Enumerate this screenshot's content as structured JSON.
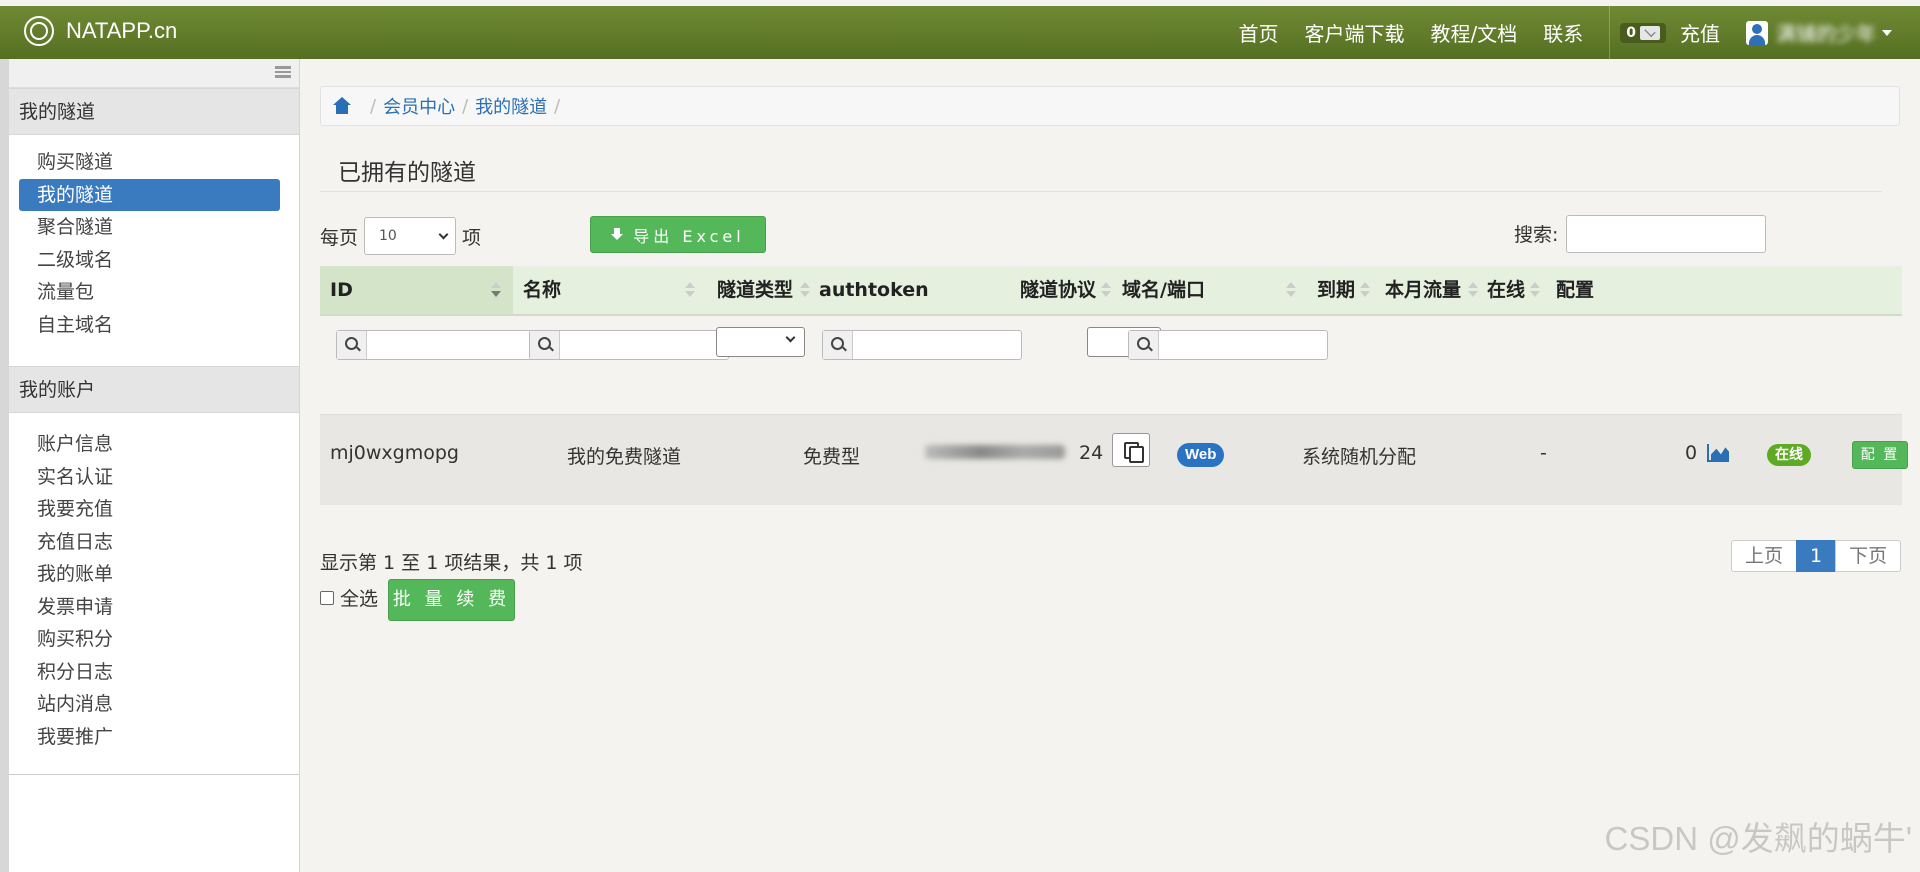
{
  "brand": "NATAPP.cn",
  "topnav": {
    "links": [
      "首页",
      "客户端下载",
      "教程/文档",
      "联系"
    ],
    "msg_count": "0",
    "recharge": "充值",
    "username": "满铺的少年"
  },
  "sidebar": {
    "section1_title": "我的隧道",
    "section1_items": [
      "购买隧道",
      "我的隧道",
      "聚合隧道",
      "二级域名",
      "流量包",
      "自主域名"
    ],
    "section2_title": "我的账户",
    "section2_items": [
      "账户信息",
      "实名认证",
      "我要充值",
      "充值日志",
      "我的账单",
      "发票申请",
      "购买积分",
      "积分日志",
      "站内消息",
      "我要推广"
    ]
  },
  "breadcrumb": [
    "会员中心",
    "我的隧道"
  ],
  "page_title": "已拥有的隧道",
  "toolbar": {
    "per_page_label": "每页",
    "per_page_value": "10",
    "per_page_suffix": "项",
    "export_label": "导出 Excel",
    "search_label": "搜索:"
  },
  "table": {
    "columns": [
      "ID",
      "名称",
      "隧道类型",
      "authtoken",
      "隧道协议",
      "域名/端口",
      "到期",
      "本月流量",
      "在线",
      "配置"
    ],
    "row": {
      "id": "mj0wxgmopg",
      "name": "我的免费隧道",
      "type": "免费型",
      "authtoken_tail": "24",
      "protocol": "Web",
      "domain": "系统随机分配",
      "expire": "-",
      "traffic": "0",
      "online": "在线",
      "config": "配 置"
    }
  },
  "footer": {
    "result_info": "显示第 1 至 1 项结果，共 1 项",
    "select_all": "全选",
    "batch_renew": "批 量 续 费",
    "prev": "上页",
    "current_page": "1",
    "next": "下页"
  },
  "watermark": "CSDN @发飙的蜗牛'"
}
